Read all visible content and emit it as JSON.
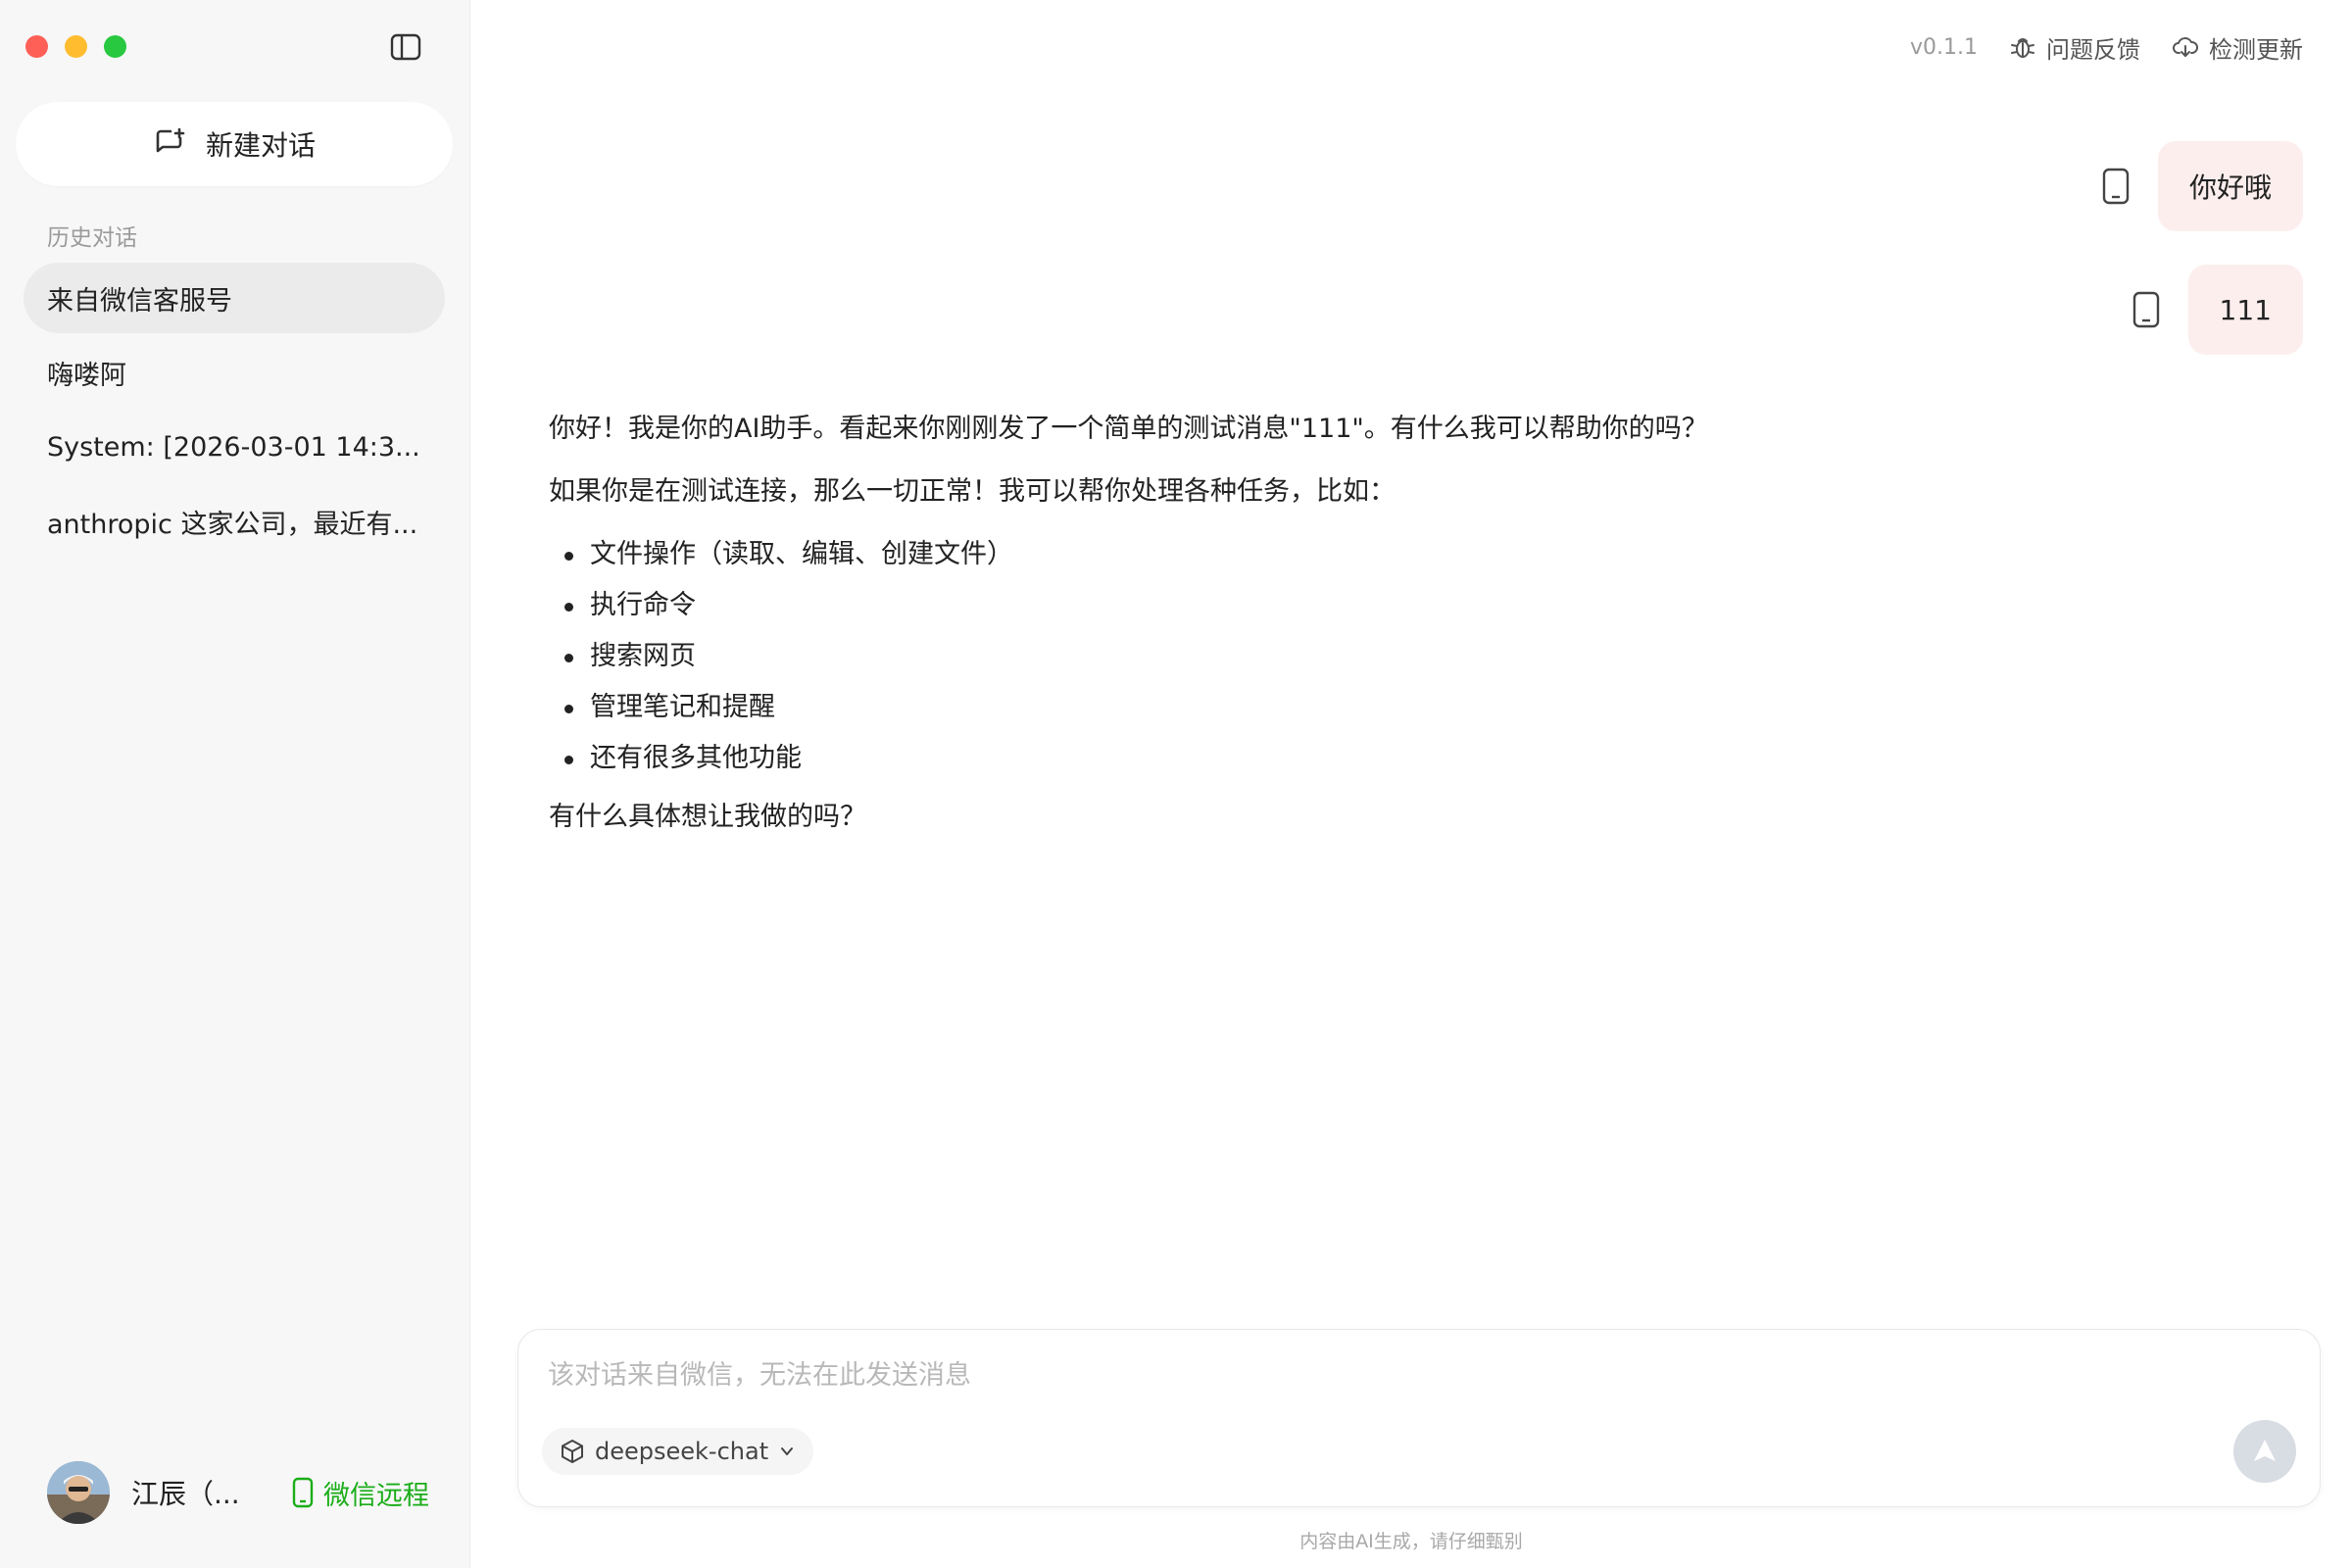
{
  "sidebar": {
    "new_chat_label": "新建对话",
    "history_heading": "历史对话",
    "items": [
      {
        "label": "来自微信客服号",
        "active": true
      },
      {
        "label": "嗨喽阿",
        "active": false
      },
      {
        "label": "System: [2026-03-01 14:3...",
        "active": false
      },
      {
        "label": "anthropic 这家公司，最近有...",
        "active": false
      }
    ],
    "user": {
      "name": "江辰（..."
    },
    "wechat_remote_label": "微信远程"
  },
  "topbar": {
    "version": "v0.1.1",
    "feedback_label": "问题反馈",
    "update_label": "检测更新"
  },
  "messages": {
    "user": [
      {
        "text": "你好哦"
      },
      {
        "text": "111"
      }
    ],
    "assistant": {
      "paragraph1": "你好！我是你的AI助手。看起来你刚刚发了一个简单的测试消息\"111\"。有什么我可以帮助你的吗？",
      "paragraph2": "如果你是在测试连接，那么一切正常！我可以帮你处理各种任务，比如：",
      "bullets": [
        "文件操作（读取、编辑、创建文件）",
        "执行命令",
        "搜索网页",
        "管理笔记和提醒",
        "还有很多其他功能"
      ],
      "paragraph3": "有什么具体想让我做的吗？"
    }
  },
  "composer": {
    "placeholder": "该对话来自微信，无法在此发送消息",
    "model": "deepseek-chat"
  },
  "disclaimer": "内容由AI生成，请仔细甄别",
  "colors": {
    "user_bubble": "#fdeeee",
    "sidebar_bg": "#f7f7f7",
    "active_item": "#ebebeb",
    "wechat_green": "#1aad19",
    "send_button_disabled": "#d8dce3"
  }
}
